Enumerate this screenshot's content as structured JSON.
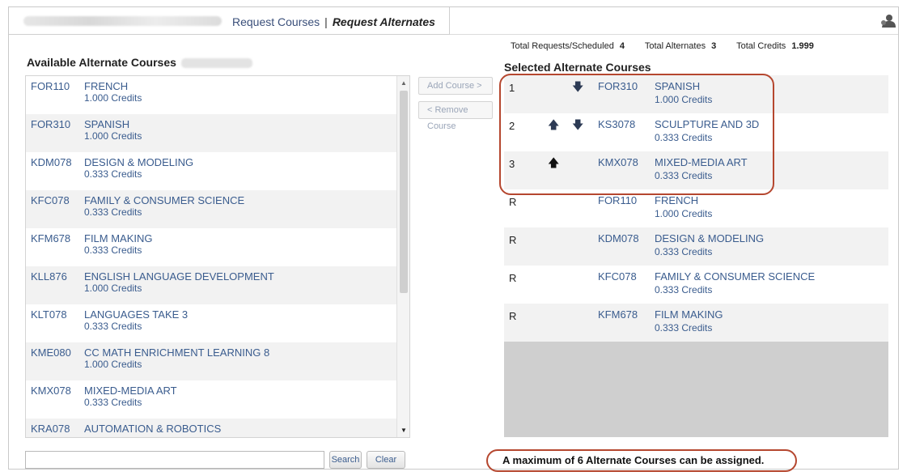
{
  "tabs": {
    "request_courses": "Request Courses",
    "separator": "|",
    "request_alternates": "Request Alternates"
  },
  "totals": {
    "requests_label": "Total Requests/Scheduled",
    "requests_value": "4",
    "alternates_label": "Total Alternates",
    "alternates_value": "3",
    "credits_label": "Total Credits",
    "credits_value": "1.999"
  },
  "left": {
    "title": "Available Alternate Courses",
    "courses": [
      {
        "code": "FOR110",
        "name": "FRENCH",
        "credits": "1.000 Credits"
      },
      {
        "code": "FOR310",
        "name": "SPANISH",
        "credits": "1.000 Credits"
      },
      {
        "code": "KDM078",
        "name": "DESIGN & MODELING",
        "credits": "0.333 Credits"
      },
      {
        "code": "KFC078",
        "name": "FAMILY & CONSUMER SCIENCE",
        "credits": "0.333 Credits"
      },
      {
        "code": "KFM678",
        "name": "FILM MAKING",
        "credits": "0.333 Credits"
      },
      {
        "code": "KLL876",
        "name": "ENGLISH LANGUAGE DEVELOPMENT",
        "credits": "1.000 Credits"
      },
      {
        "code": "KLT078",
        "name": "LANGUAGES TAKE 3",
        "credits": "0.333 Credits"
      },
      {
        "code": "KME080",
        "name": "CC MATH ENRICHMENT LEARNING 8",
        "credits": "1.000 Credits"
      },
      {
        "code": "KMX078",
        "name": "MIXED-MEDIA ART",
        "credits": "0.333 Credits"
      },
      {
        "code": "KRA078",
        "name": "AUTOMATION & ROBOTICS",
        "credits": ""
      }
    ],
    "search_value": "",
    "search_label": "Search",
    "clear_label": "Clear"
  },
  "middle": {
    "add_label": "Add Course >",
    "remove_label": "< Remove Course"
  },
  "right": {
    "title": "Selected Alternate Courses",
    "courses": [
      {
        "order": "1",
        "code": "FOR310",
        "name": "SPANISH",
        "credits": "1.000 Credits"
      },
      {
        "order": "2",
        "code": "KS3078",
        "name": "SCULPTURE AND 3D",
        "credits": "0.333 Credits"
      },
      {
        "order": "3",
        "code": "KMX078",
        "name": "MIXED-MEDIA ART",
        "credits": "0.333 Credits"
      },
      {
        "order": "R",
        "code": "FOR110",
        "name": "FRENCH",
        "credits": "1.000 Credits"
      },
      {
        "order": "R",
        "code": "KDM078",
        "name": "DESIGN & MODELING",
        "credits": "0.333 Credits"
      },
      {
        "order": "R",
        "code": "KFC078",
        "name": "FAMILY & CONSUMER SCIENCE",
        "credits": "0.333 Credits"
      },
      {
        "order": "R",
        "code": "KFM678",
        "name": "FILM MAKING",
        "credits": "0.333 Credits"
      }
    ],
    "note": "A maximum of 6 Alternate Courses can be assigned."
  },
  "icons": {
    "up": "arrow-up-icon",
    "down": "arrow-down-icon",
    "user": "person-icon"
  },
  "colors": {
    "link": "#3a5c8e",
    "highlight": "#b5472f",
    "stripe": "#f2f2f2"
  }
}
